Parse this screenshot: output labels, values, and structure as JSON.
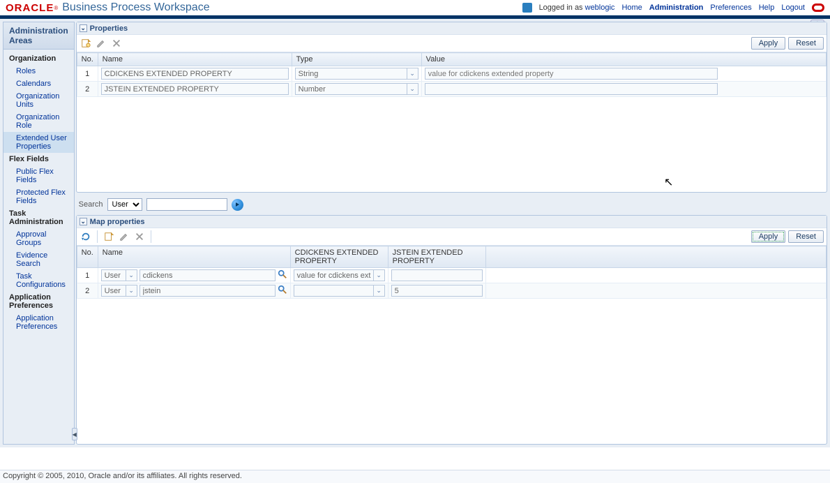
{
  "header": {
    "brand_logo": "ORACLE",
    "brand_reg": "®",
    "app_title": "Business Process Workspace",
    "logged_prefix": "Logged in as ",
    "user": "weblogic",
    "links": {
      "home": "Home",
      "administration": "Administration",
      "preferences": "Preferences",
      "help": "Help",
      "logout": "Logout"
    }
  },
  "sidebar": {
    "title": "Administration Areas",
    "groups": [
      {
        "label": "Organization",
        "items": [
          {
            "label": "Roles"
          },
          {
            "label": "Calendars"
          },
          {
            "label": "Organization Units"
          },
          {
            "label": "Organization Role"
          },
          {
            "label": "Extended User Properties",
            "selected": true
          }
        ]
      },
      {
        "label": "Flex Fields",
        "items": [
          {
            "label": "Public Flex Fields"
          },
          {
            "label": "Protected Flex Fields"
          }
        ]
      },
      {
        "label": "Task Administration",
        "items": [
          {
            "label": "Approval Groups"
          },
          {
            "label": "Evidence Search"
          },
          {
            "label": "Task Configurations"
          }
        ]
      },
      {
        "label": "Application Preferences",
        "items": [
          {
            "label": "Application Preferences"
          }
        ]
      }
    ]
  },
  "properties_panel": {
    "title": "Properties",
    "buttons": {
      "apply": "Apply",
      "reset": "Reset"
    },
    "columns": {
      "no": "No.",
      "name": "Name",
      "type": "Type",
      "value": "Value"
    },
    "rows": [
      {
        "no": "1",
        "name": "CDICKENS EXTENDED PROPERTY",
        "type": "String",
        "value": "value for cdickens extended property"
      },
      {
        "no": "2",
        "name": "JSTEIN EXTENDED PROPERTY",
        "type": "Number",
        "value": ""
      }
    ]
  },
  "search": {
    "label": "Search",
    "type_options": [
      "User"
    ],
    "type_selected": "User",
    "query": ""
  },
  "map_panel": {
    "title": "Map properties",
    "buttons": {
      "apply": "Apply",
      "reset": "Reset"
    },
    "columns": {
      "no": "No.",
      "name": "Name",
      "cdickens": "CDICKENS EXTENDED PROPERTY",
      "jstein": "JSTEIN EXTENDED PROPERTY"
    },
    "rows": [
      {
        "no": "1",
        "type": "User",
        "name": "cdickens",
        "cdickens": "value for cdickens ext",
        "jstein": ""
      },
      {
        "no": "2",
        "type": "User",
        "name": "jstein",
        "cdickens": "",
        "jstein": "5"
      }
    ]
  },
  "footer": "Copyright © 2005, 2010, Oracle and/or its affiliates. All rights reserved."
}
